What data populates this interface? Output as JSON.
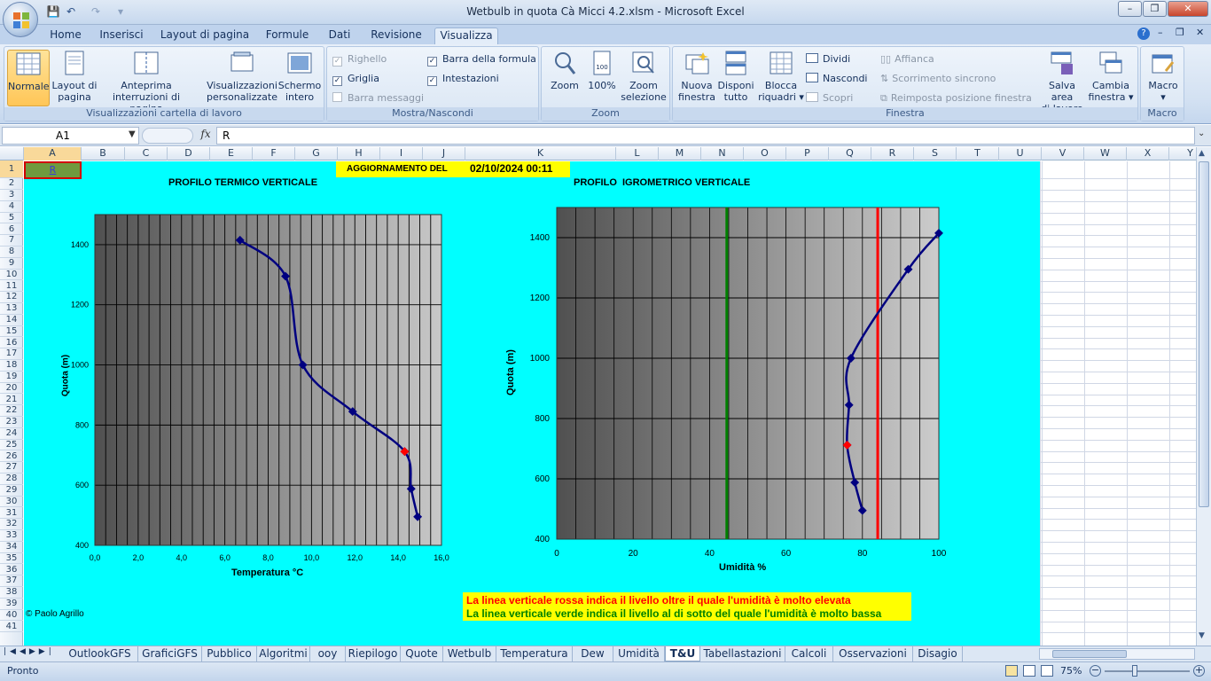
{
  "window": {
    "title": "Wetbulb in quota Cà Micci 4.2.xlsm - Microsoft Excel",
    "minimize": "–",
    "restore": "❐",
    "close": "✕"
  },
  "ribbon_tabs": [
    "Home",
    "Inserisci",
    "Layout di pagina",
    "Formule",
    "Dati",
    "Revisione",
    "Visualizza"
  ],
  "active_tab": "Visualizza",
  "ribbon": {
    "group1": {
      "label": "Visualizzazioni cartella di lavoro",
      "normale": "Normale",
      "layout_l1": "Layout di",
      "layout_l2": "pagina",
      "anteprima_l1": "Anteprima",
      "anteprima_l2": "interruzioni di pagina",
      "visual_l1": "Visualizzazioni",
      "visual_l2": "personalizzate",
      "schermo_l1": "Schermo",
      "schermo_l2": "intero"
    },
    "group2": {
      "label": "Mostra/Nascondi",
      "righello": "Righello",
      "griglia": "Griglia",
      "barra_messaggi": "Barra messaggi",
      "barra_formula": "Barra della formula",
      "intestazioni": "Intestazioni"
    },
    "group3": {
      "label": "Zoom",
      "zoom": "Zoom",
      "cento": "100%",
      "zoomsel_l1": "Zoom",
      "zoomsel_l2": "selezione"
    },
    "group4": {
      "label": "Finestra",
      "nuova_l1": "Nuova",
      "nuova_l2": "finestra",
      "disponi_l1": "Disponi",
      "disponi_l2": "tutto",
      "blocca_l1": "Blocca",
      "blocca_l2": "riquadri",
      "dividi": "Dividi",
      "nascondi": "Nascondi",
      "scopri": "Scopri",
      "affianca": "Affianca",
      "scorrimento": "Scorrimento sincrono",
      "reimposta": "Reimposta posizione finestra",
      "salva_l1": "Salva area",
      "salva_l2": "di lavoro",
      "cambia_l1": "Cambia",
      "cambia_l2": "finestra"
    },
    "group5": {
      "label": "Macro",
      "macro": "Macro"
    }
  },
  "formula_bar": {
    "namebox": "A1",
    "fx": "fx",
    "value": "R"
  },
  "columns": [
    "A",
    "B",
    "C",
    "D",
    "E",
    "F",
    "G",
    "H",
    "I",
    "J",
    "K",
    "L",
    "M",
    "N",
    "O",
    "P",
    "Q",
    "R",
    "S",
    "T",
    "U",
    "V",
    "W",
    "X",
    "Y",
    "Z"
  ],
  "rows": [
    "1",
    "2",
    "3",
    "4",
    "5",
    "6",
    "7",
    "8",
    "9",
    "10",
    "11",
    "12",
    "13",
    "14",
    "15",
    "16",
    "17",
    "18",
    "19",
    "20",
    "21",
    "22",
    "23",
    "24",
    "25",
    "26",
    "27",
    "28",
    "29",
    "30",
    "31",
    "32",
    "33",
    "34",
    "35",
    "36",
    "37",
    "38",
    "39",
    "40",
    "41"
  ],
  "sheet": {
    "cell_a1": "R",
    "update_label": "AGGIORNAMENTO DEL",
    "update_value": "02/10/2024 00:11",
    "credit": "© Paolo Agrillo",
    "note_red": "La linea verticale rossa indica il livello oltre il quale l'umidità è molto elevata",
    "note_green": "La linea verticale verde indica il livello al di sotto del quale l'umidità è molto bassa",
    "colors": {
      "background": "#00ffff",
      "note_box": "#ffff00",
      "red_text": "#ff0000",
      "green_text": "#008000"
    }
  },
  "chart_data": [
    {
      "type": "line",
      "title": "PROFILO TERMICO VERTICALE",
      "xlabel": "Temperatura °C",
      "ylabel": "Quota (m)",
      "xlim": [
        0,
        16
      ],
      "ylim": [
        400,
        1500
      ],
      "xticks": [
        "0,0",
        "2,0",
        "4,0",
        "6,0",
        "8,0",
        "10,0",
        "12,0",
        "14,0",
        "16,0"
      ],
      "yticks": [
        "400",
        "600",
        "800",
        "1000",
        "1200",
        "1400"
      ],
      "series": [
        {
          "x": [
            6.7,
            8.8,
            9.6,
            11.9,
            14.3,
            14.6,
            14.9
          ],
          "y": [
            1415,
            1295,
            1000,
            845,
            712,
            588,
            495
          ]
        }
      ],
      "highlight_point": {
        "x": 14.3,
        "y": 712
      },
      "colors": {
        "line": "#000080",
        "highlight": "#ff0000"
      }
    },
    {
      "type": "line",
      "title": "PROFILO  IGROMETRICO VERTICALE",
      "xlabel": "Umidità %",
      "ylabel": "Quota (m)",
      "xlim": [
        0,
        100
      ],
      "ylim": [
        400,
        1500
      ],
      "xticks": [
        "0",
        "20",
        "40",
        "60",
        "80",
        "100"
      ],
      "yticks": [
        "400",
        "600",
        "800",
        "1000",
        "1200",
        "1400"
      ],
      "series": [
        {
          "x": [
            100,
            92,
            77,
            76.5,
            76,
            78,
            80
          ],
          "y": [
            1415,
            1295,
            1000,
            845,
            712,
            588,
            495
          ]
        }
      ],
      "highlight_point": {
        "x": 76,
        "y": 712
      },
      "reference_lines": {
        "green_x": 44.5,
        "red_x": 84
      },
      "colors": {
        "line": "#000080",
        "highlight": "#ff0000",
        "green": "#008000",
        "red": "#ff0000"
      }
    }
  ],
  "sheet_tabs": [
    "OutlookGFS",
    "GraficiGFS",
    "Pubblico",
    "Algoritmi",
    "ooy",
    "Riepilogo",
    "Quote",
    "Wetbulb",
    "Temperatura",
    "Dew",
    "Umidità",
    "T&U",
    "Tabellastazioni",
    "Calcoli",
    "Osservazioni",
    "Disagio"
  ],
  "active_sheet": "T&U",
  "status": {
    "ready": "Pronto",
    "zoom": "75%"
  }
}
